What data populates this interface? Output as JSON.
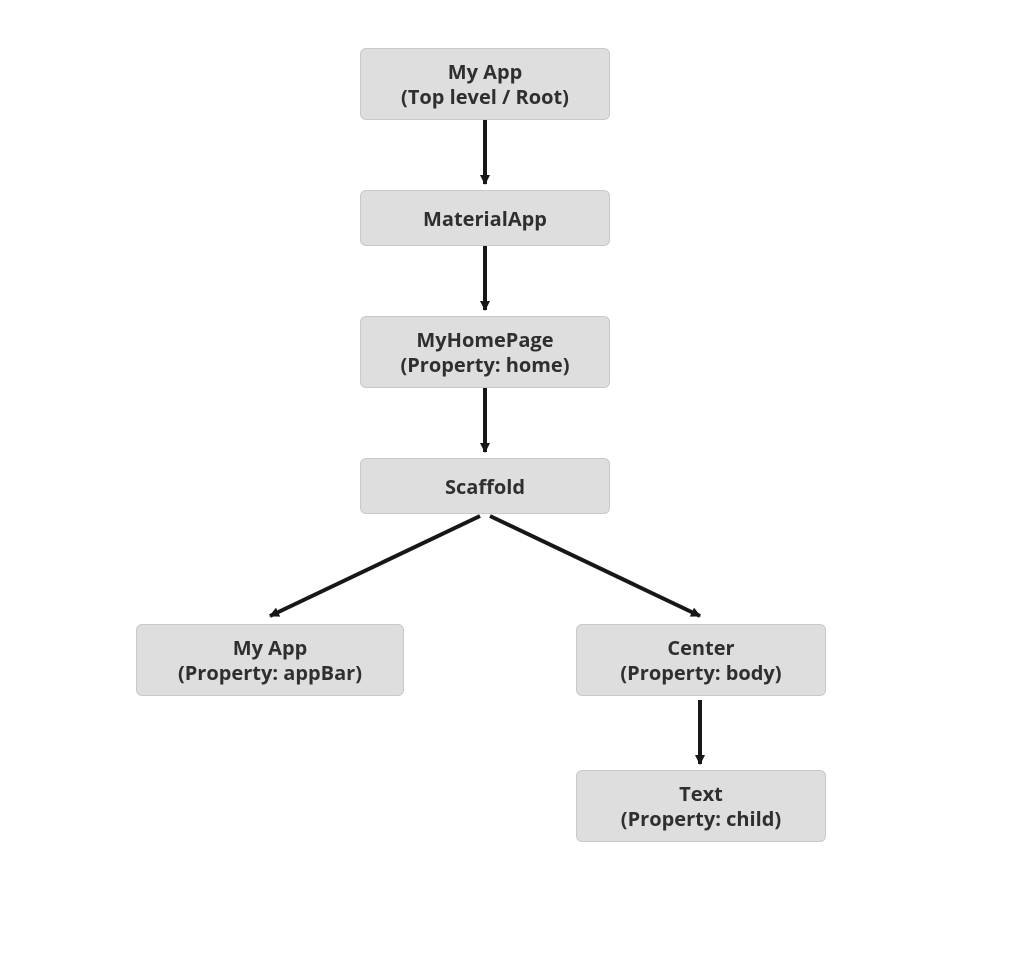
{
  "diagram": {
    "nodes": {
      "root": {
        "line1": "My App",
        "line2": "(Top level / Root)"
      },
      "material": {
        "line1": "MaterialApp",
        "line2": ""
      },
      "home": {
        "line1": "MyHomePage",
        "line2": "(Property: home)"
      },
      "scaffold": {
        "line1": "Scaffold",
        "line2": ""
      },
      "appbar": {
        "line1": "My App",
        "line2": "(Property: appBar)"
      },
      "center": {
        "line1": "Center",
        "line2": "(Property: body)"
      },
      "text": {
        "line1": "Text",
        "line2": "(Property: child)"
      }
    },
    "edges": [
      {
        "from": "root",
        "to": "material"
      },
      {
        "from": "material",
        "to": "home"
      },
      {
        "from": "home",
        "to": "scaffold"
      },
      {
        "from": "scaffold",
        "to": "appbar"
      },
      {
        "from": "scaffold",
        "to": "center"
      },
      {
        "from": "center",
        "to": "text"
      }
    ],
    "style": {
      "node_fill": "#dedede",
      "node_border": "#c9c9c9",
      "text_color": "#2f2f2f",
      "arrow_color": "#171717"
    }
  }
}
